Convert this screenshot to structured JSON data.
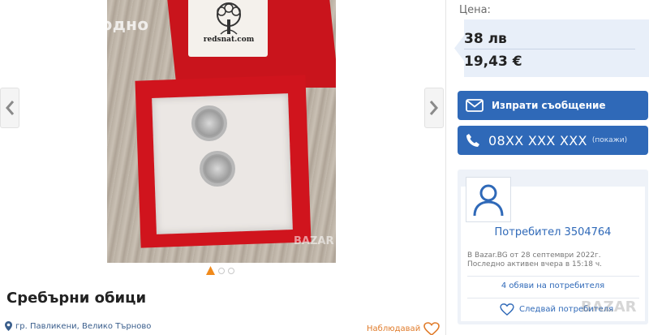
{
  "gallery": {
    "watermark": "Купи изгодно",
    "lid_brand": "redsnat.com",
    "photo_watermark": "BAZAR",
    "slide_count": 3,
    "active_slide": 1,
    "prev_icon": "chevron-left-icon",
    "next_icon": "chevron-right-icon"
  },
  "listing": {
    "title": "Сребърни обици",
    "location": "гр. Павликени, Велико Търново",
    "watch_label": "Наблюдавай"
  },
  "price": {
    "label": "Цена:",
    "bgn": "38 лв",
    "eur": "19,43 €"
  },
  "actions": {
    "message_label": "Изпрати съобщение",
    "phone_number": "08XX XXX XXX",
    "phone_reveal": "(покажи)"
  },
  "seller": {
    "name": "Потребител 3504764",
    "joined": "В Bazar.BG от 28 септември 2022г.",
    "last_active": "Последно активен вчера в 15:18 ч.",
    "ads_link": "4 обяви на потребителя",
    "follow_label": "Следвай потребителя"
  },
  "site_watermark": "BAZAR",
  "colors": {
    "accent": "#2f69b8",
    "orange": "#e07b2a",
    "price_bg": "#e8eff9"
  }
}
